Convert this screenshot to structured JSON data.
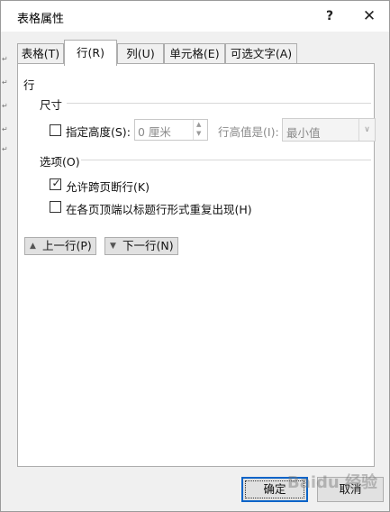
{
  "window": {
    "title": "表格属性",
    "help_label": "?",
    "close_label": "✕"
  },
  "tabs": [
    {
      "label": "表格(T)",
      "active": false
    },
    {
      "label": "行(R)",
      "active": true
    },
    {
      "label": "列(U)",
      "active": false
    },
    {
      "label": "单元格(E)",
      "active": false
    },
    {
      "label": "可选文字(A)",
      "active": false
    }
  ],
  "row_panel": {
    "section_title": "行",
    "size_group": "尺寸",
    "specify_height": {
      "label": "指定高度(S):",
      "checked": false
    },
    "height_value": "0 厘米",
    "row_height_is_label": "行高值是(I):",
    "row_height_mode": "最小值",
    "options_group": "选项(O)",
    "allow_break": {
      "label": "允许跨页断行(K)",
      "checked": true
    },
    "repeat_header": {
      "label": "在各页顶端以标题行形式重复出现(H)",
      "checked": false
    },
    "prev_row": "上一行(P)",
    "next_row": "下一行(N)"
  },
  "footer": {
    "ok_label": "确定",
    "cancel_label": "取消"
  },
  "icons": {
    "up": "▲",
    "down": "▼",
    "check": "✓",
    "dropdown": "∨"
  },
  "watermark": "Baidu 经验"
}
